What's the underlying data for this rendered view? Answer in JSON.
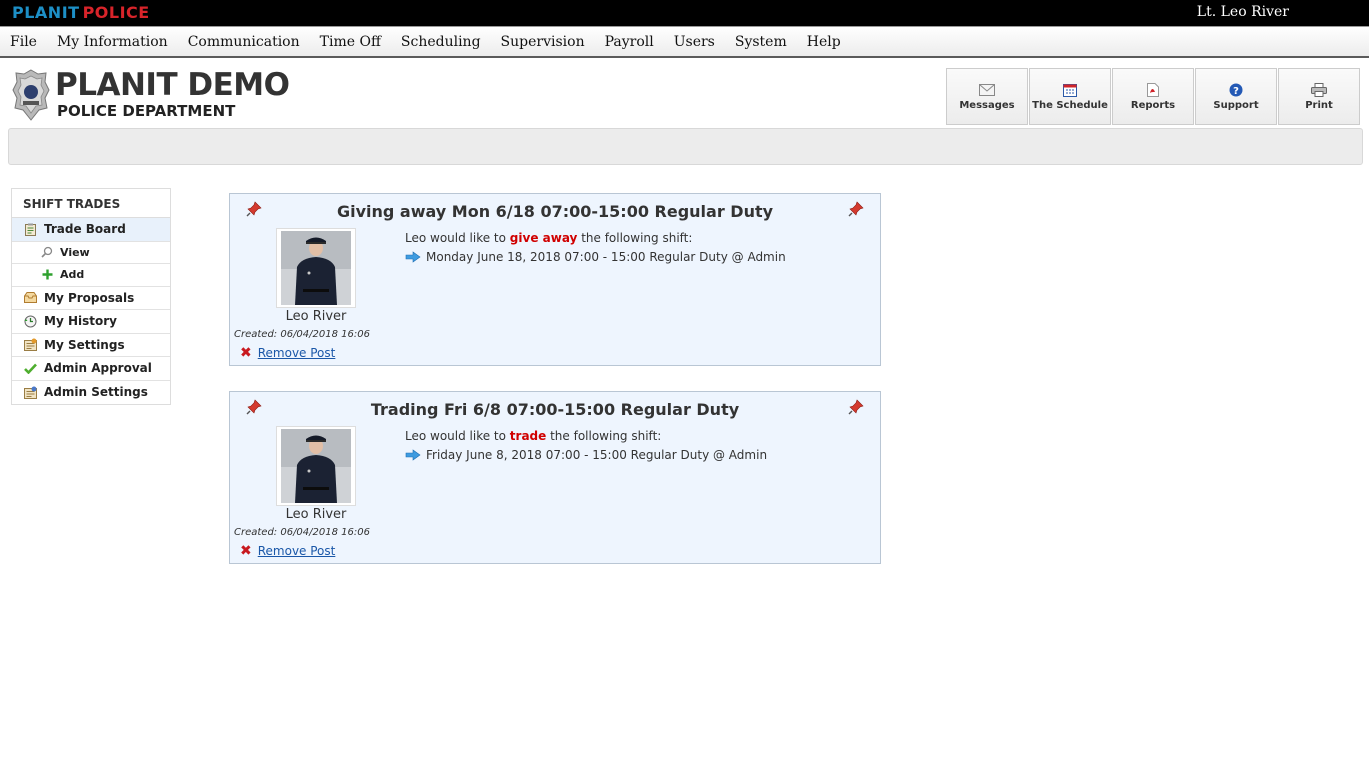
{
  "brand": {
    "logo_part1": "PLANIT",
    "logo_part2": "POLICE"
  },
  "user": {
    "display_name": "Lt. Leo River"
  },
  "menu": [
    "File",
    "My Information",
    "Communication",
    "Time Off",
    "Scheduling",
    "Supervision",
    "Payroll",
    "Users",
    "System",
    "Help"
  ],
  "header": {
    "title": "PLANIT DEMO",
    "subtitle": "POLICE DEPARTMENT"
  },
  "toolbar": [
    {
      "label": "Messages",
      "icon": "envelope-icon"
    },
    {
      "label": "The Schedule",
      "icon": "calendar-icon"
    },
    {
      "label": "Reports",
      "icon": "pdf-icon"
    },
    {
      "label": "Support",
      "icon": "help-icon"
    },
    {
      "label": "Print",
      "icon": "printer-icon"
    }
  ],
  "sidebar": {
    "heading": "SHIFT TRADES",
    "items": [
      {
        "label": "Trade Board",
        "icon": "clipboard-icon"
      },
      {
        "label": "View",
        "icon": "magnifier-icon"
      },
      {
        "label": "Add",
        "icon": "plus-icon"
      },
      {
        "label": "My Proposals",
        "icon": "inbox-icon"
      },
      {
        "label": "My History",
        "icon": "history-icon"
      },
      {
        "label": "My Settings",
        "icon": "settings-icon"
      },
      {
        "label": "Admin Approval",
        "icon": "checkmark-icon"
      },
      {
        "label": "Admin Settings",
        "icon": "admin-settings-icon"
      }
    ]
  },
  "posts": [
    {
      "title": "Giving away Mon 6/18 07:00-15:00 Regular Duty",
      "name": "Leo River",
      "created": "Created: 06/04/2018 16:06",
      "msg_pre": "Leo would like to ",
      "msg_action": "give away",
      "msg_post": " the following shift:",
      "shift": "Monday June 18, 2018 07:00 - 15:00 Regular Duty @ Admin",
      "remove_label": "Remove Post"
    },
    {
      "title": "Trading Fri 6/8 07:00-15:00 Regular Duty",
      "name": "Leo River",
      "created": "Created: 06/04/2018 16:06",
      "msg_pre": "Leo would like to ",
      "msg_action": "trade",
      "msg_post": " the following shift:",
      "shift": "Friday June 8, 2018 07:00 - 15:00 Regular Duty @ Admin",
      "remove_label": "Remove Post"
    }
  ],
  "colors": {
    "accent_red": "#d00000",
    "link_blue": "#1a57a8",
    "post_bg": "#eef5fe"
  }
}
